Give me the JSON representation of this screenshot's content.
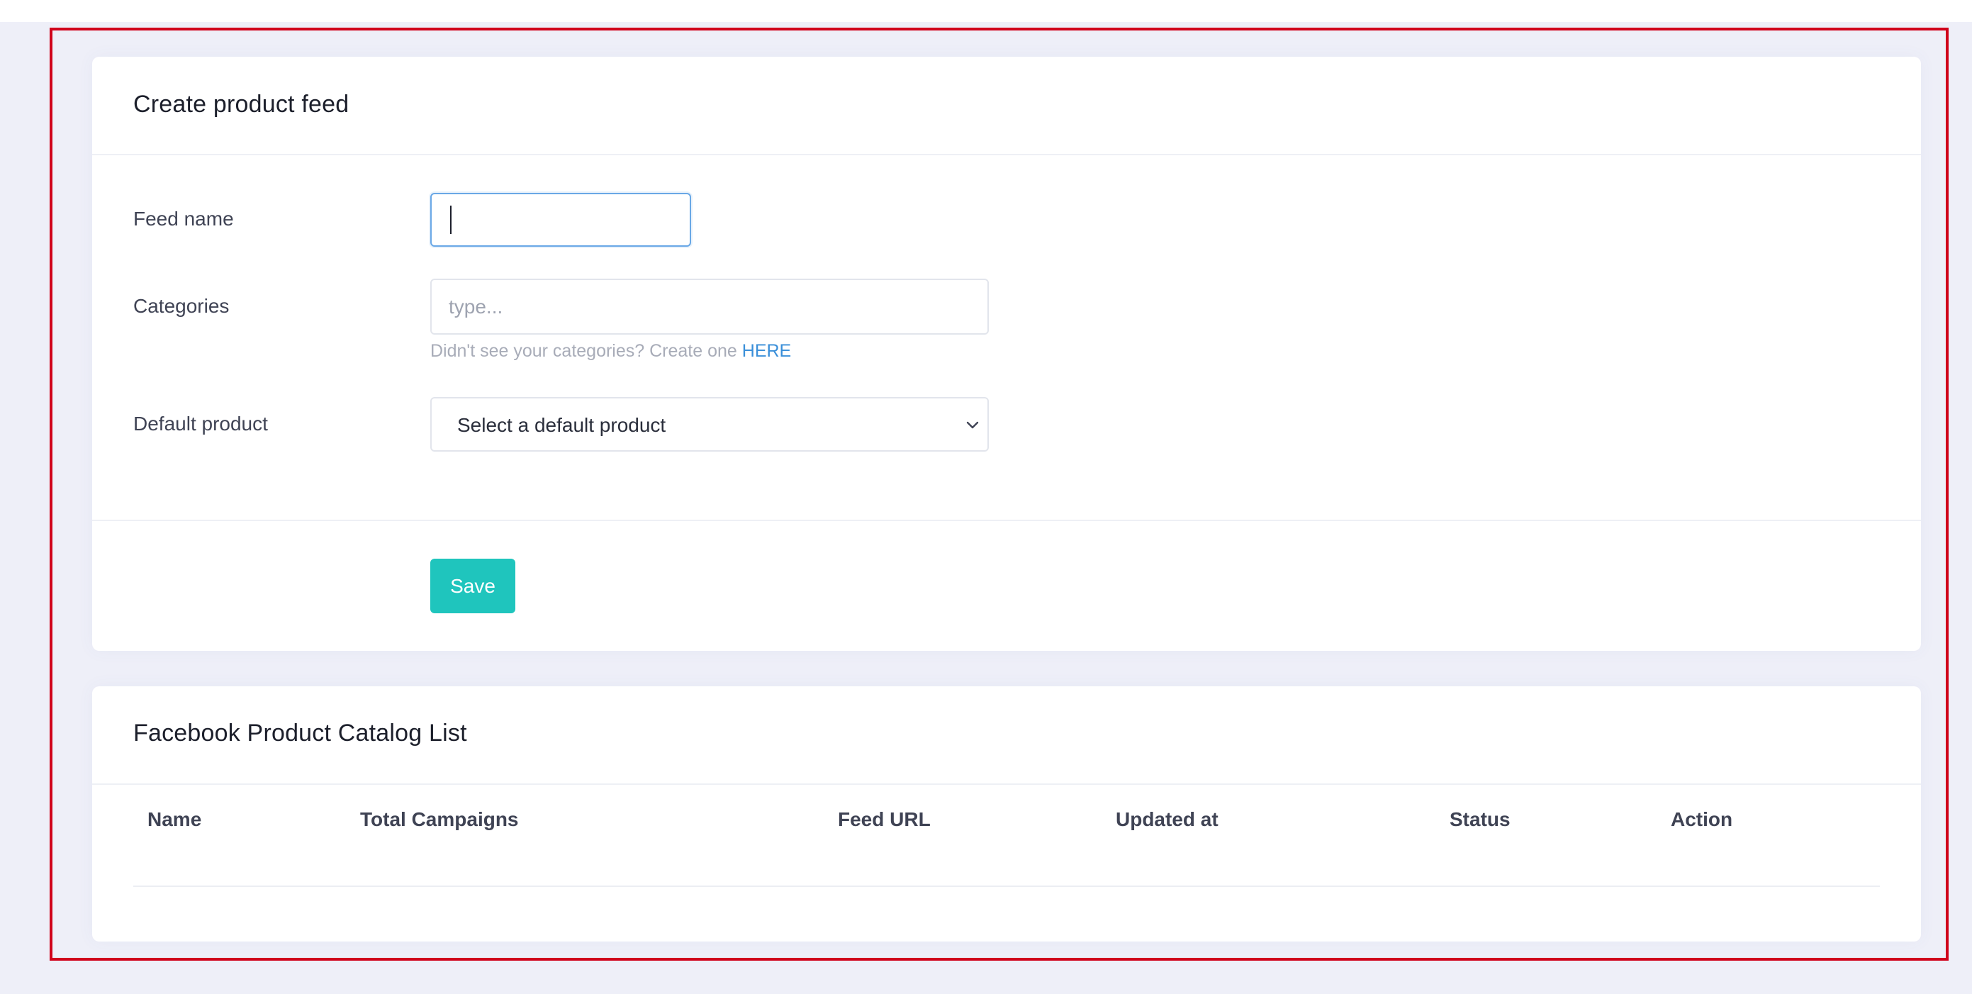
{
  "create_feed": {
    "title": "Create product feed",
    "feed_name_label": "Feed name",
    "feed_name_value": "",
    "categories_label": "Categories",
    "categories_placeholder": "type...",
    "helper_text": "Didn't see your categories? Create one",
    "helper_link": "HERE",
    "default_product_label": "Default product",
    "default_product_selected": "Select a default product",
    "save_label": "Save"
  },
  "catalog_list": {
    "title": "Facebook Product Catalog List",
    "columns": [
      "Name",
      "Total Campaigns",
      "Feed URL",
      "Updated at",
      "Status",
      "Action"
    ],
    "rows": []
  },
  "colors": {
    "page_background": "#eeeff8",
    "card_background": "#ffffff",
    "primary_button": "#1fc5bd",
    "link": "#3a8fd9",
    "highlight_frame": "#d0021b",
    "focus_border": "#6aa8e6"
  },
  "icons": {
    "select_arrow": "chevron-down-icon"
  }
}
